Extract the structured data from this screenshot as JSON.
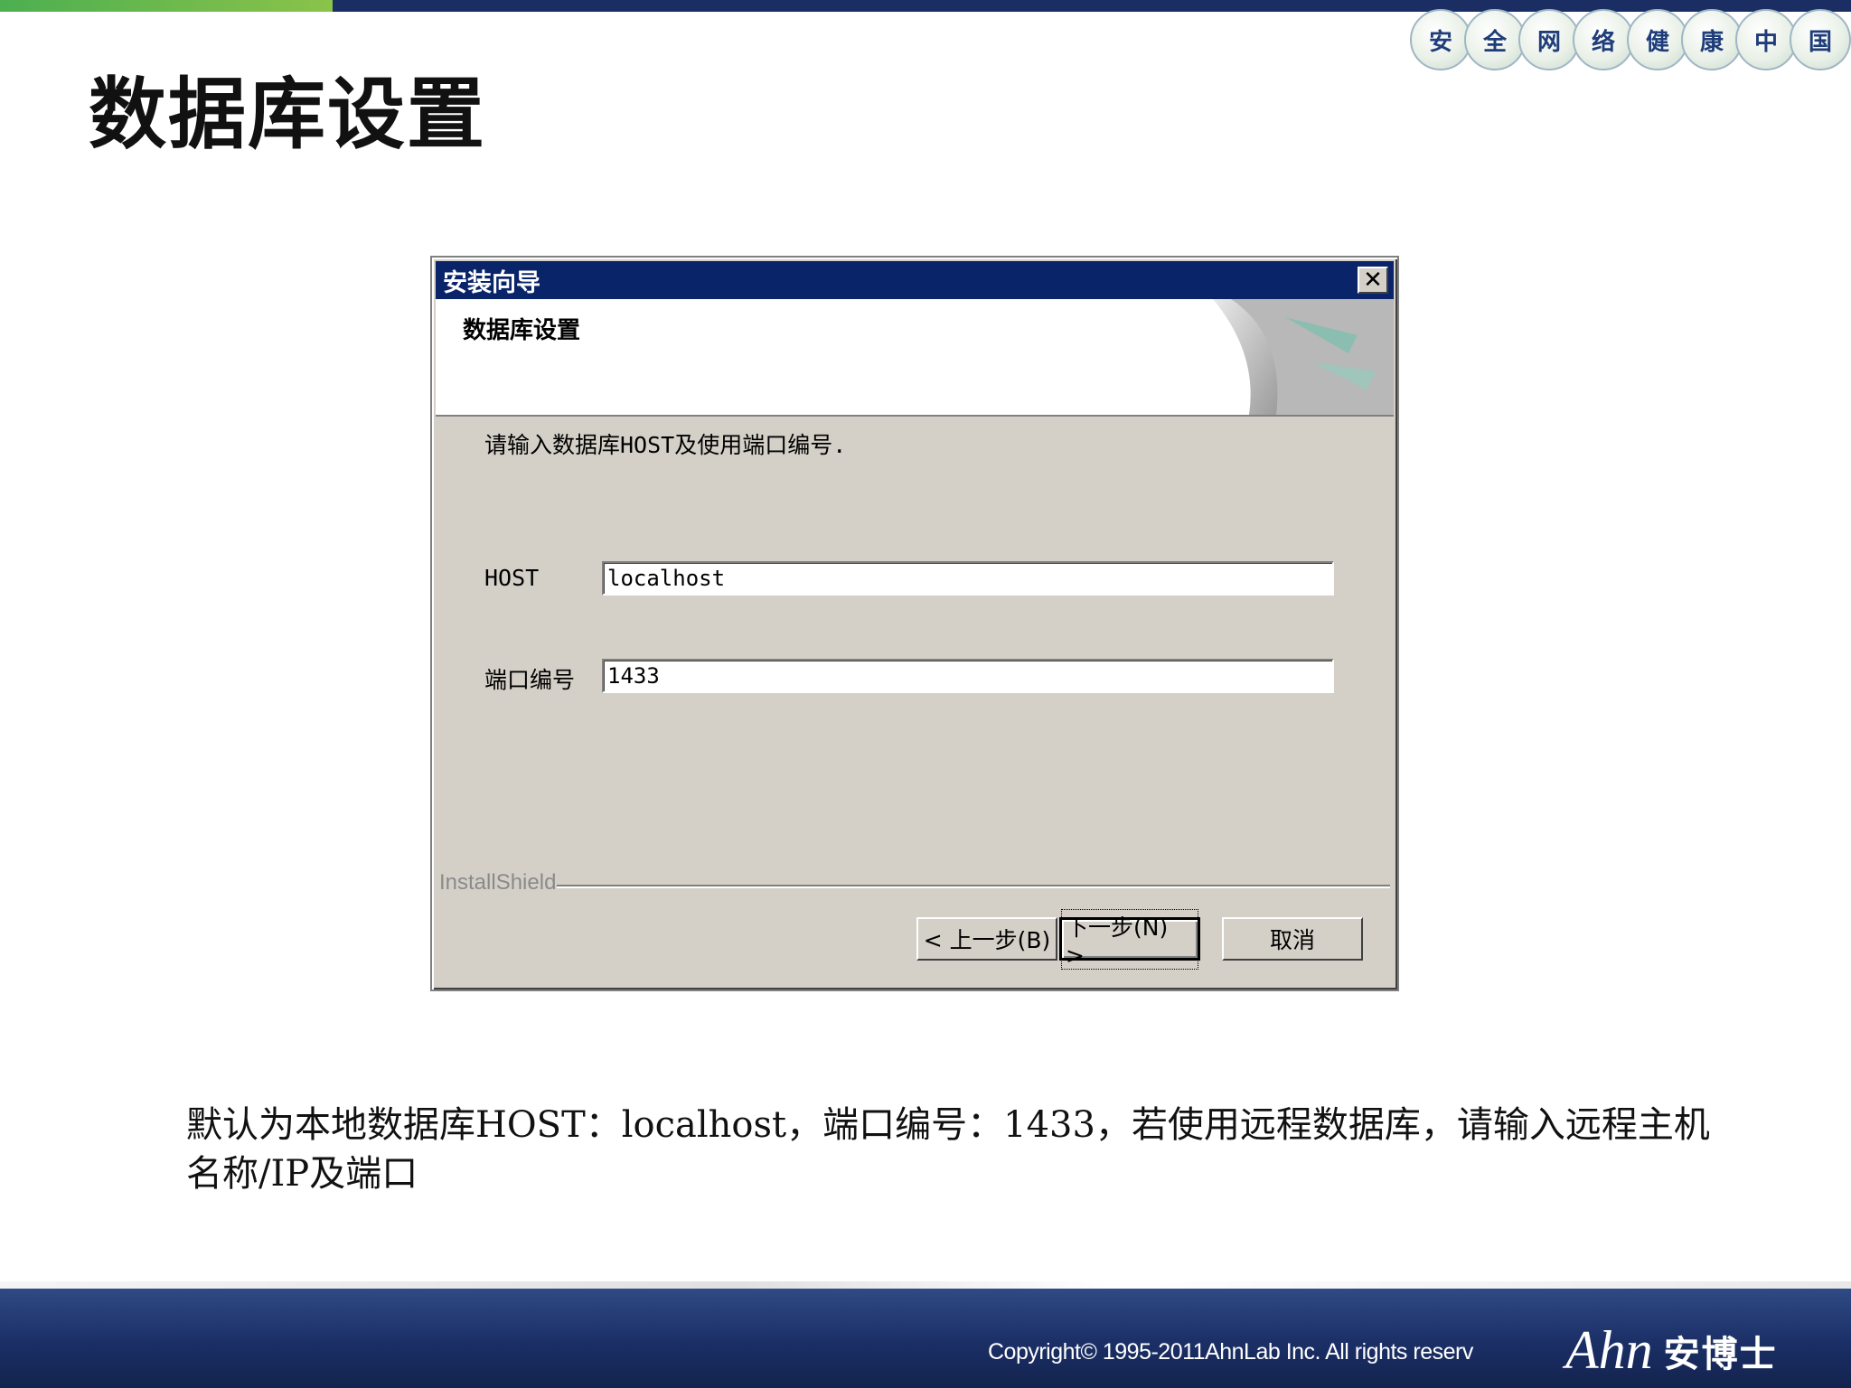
{
  "slogan_chars": [
    "安",
    "全",
    "网",
    "络",
    "健",
    "康",
    "中",
    "国"
  ],
  "page_title": "数据库设置",
  "dialog": {
    "window_title": "安装向导",
    "close_symbol": "✕",
    "header_title": "数据库设置",
    "instruction": "请输入数据库HOST及使用端口编号.",
    "host_label": "HOST",
    "host_value": "localhost",
    "port_label": "端口编号",
    "port_value": "1433",
    "installshield": "InstallShield",
    "back_button": "< 上一步(B)",
    "next_button": "下一步(N) >",
    "cancel_button": "取消"
  },
  "description": "默认为本地数据库HOST：localhost，端口编号：1433，若使用远程数据库，请输入远程主机名称/IP及端口",
  "footer": {
    "copyright": "Copyright© 1995-2011AhnLab Inc. All rights reserv",
    "logo_latin": "Ahn",
    "logo_cn": "安博士"
  },
  "colors": {
    "titlebar": "#0a246a",
    "dialog_bg": "#d4d0c8",
    "footer": "#1b2f66",
    "accent_green": "#4caf50"
  }
}
